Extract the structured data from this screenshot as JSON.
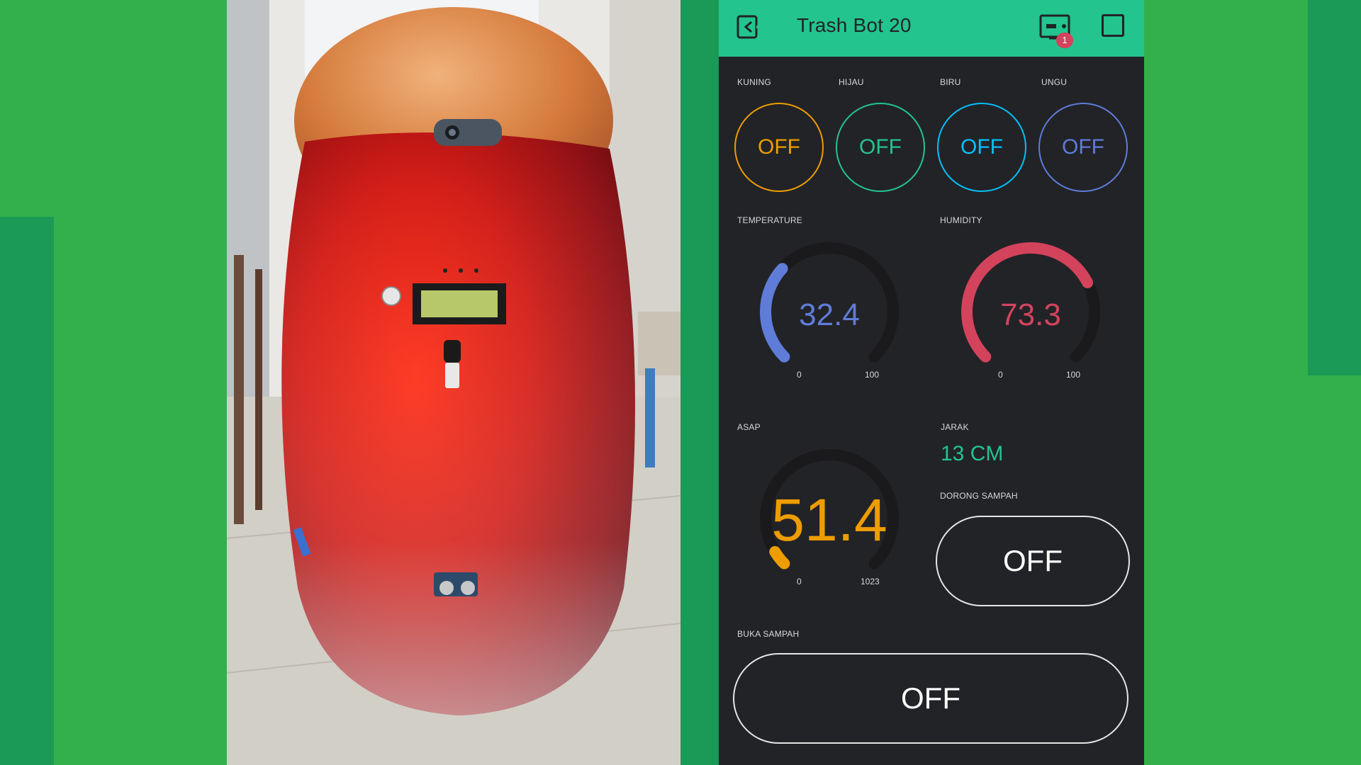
{
  "app": {
    "title": "Trash Bot 20",
    "notification_count": "1",
    "colors": {
      "header": "#23c48e",
      "background": "#222327",
      "yellow": "#ed9d00",
      "green": "#23c48e",
      "teal": "#04c0f8",
      "purple": "#5f7cd8",
      "red": "#d3435c"
    },
    "icons": {
      "back": "back-icon",
      "device": "device-icon",
      "stop": "stop-icon"
    }
  },
  "buttons_row": [
    {
      "label": "KUNING",
      "value": "OFF",
      "color": "#ed9d00"
    },
    {
      "label": "HIJAU",
      "value": "OFF",
      "color": "#23c48e"
    },
    {
      "label": "BIRU",
      "value": "OFF",
      "color": "#04c0f8"
    },
    {
      "label": "UNGU",
      "value": "OFF",
      "color": "#5f7cd8"
    }
  ],
  "gauges": {
    "temperature": {
      "label": "TEMPERATURE",
      "value": "32.4",
      "min": "0",
      "max": "100",
      "numeric": 32.4,
      "range": 100,
      "color": "#5f7cd8"
    },
    "humidity": {
      "label": "HUMIDITY",
      "value": "73.3",
      "min": "0",
      "max": "100",
      "numeric": 73.3,
      "range": 100,
      "color": "#d3435c"
    },
    "asap": {
      "label": "ASAP",
      "value": "51.4",
      "min": "0",
      "max": "1023",
      "numeric": 51.4,
      "range": 1023,
      "color": "#ed9d00"
    }
  },
  "jarak": {
    "label": "JARAK",
    "value": "13 CM"
  },
  "dorong_sampah": {
    "label": "DORONG SAMPAH",
    "value": "OFF"
  },
  "buka_sampah": {
    "label": "BUKA SAMPAH",
    "value": "OFF"
  }
}
